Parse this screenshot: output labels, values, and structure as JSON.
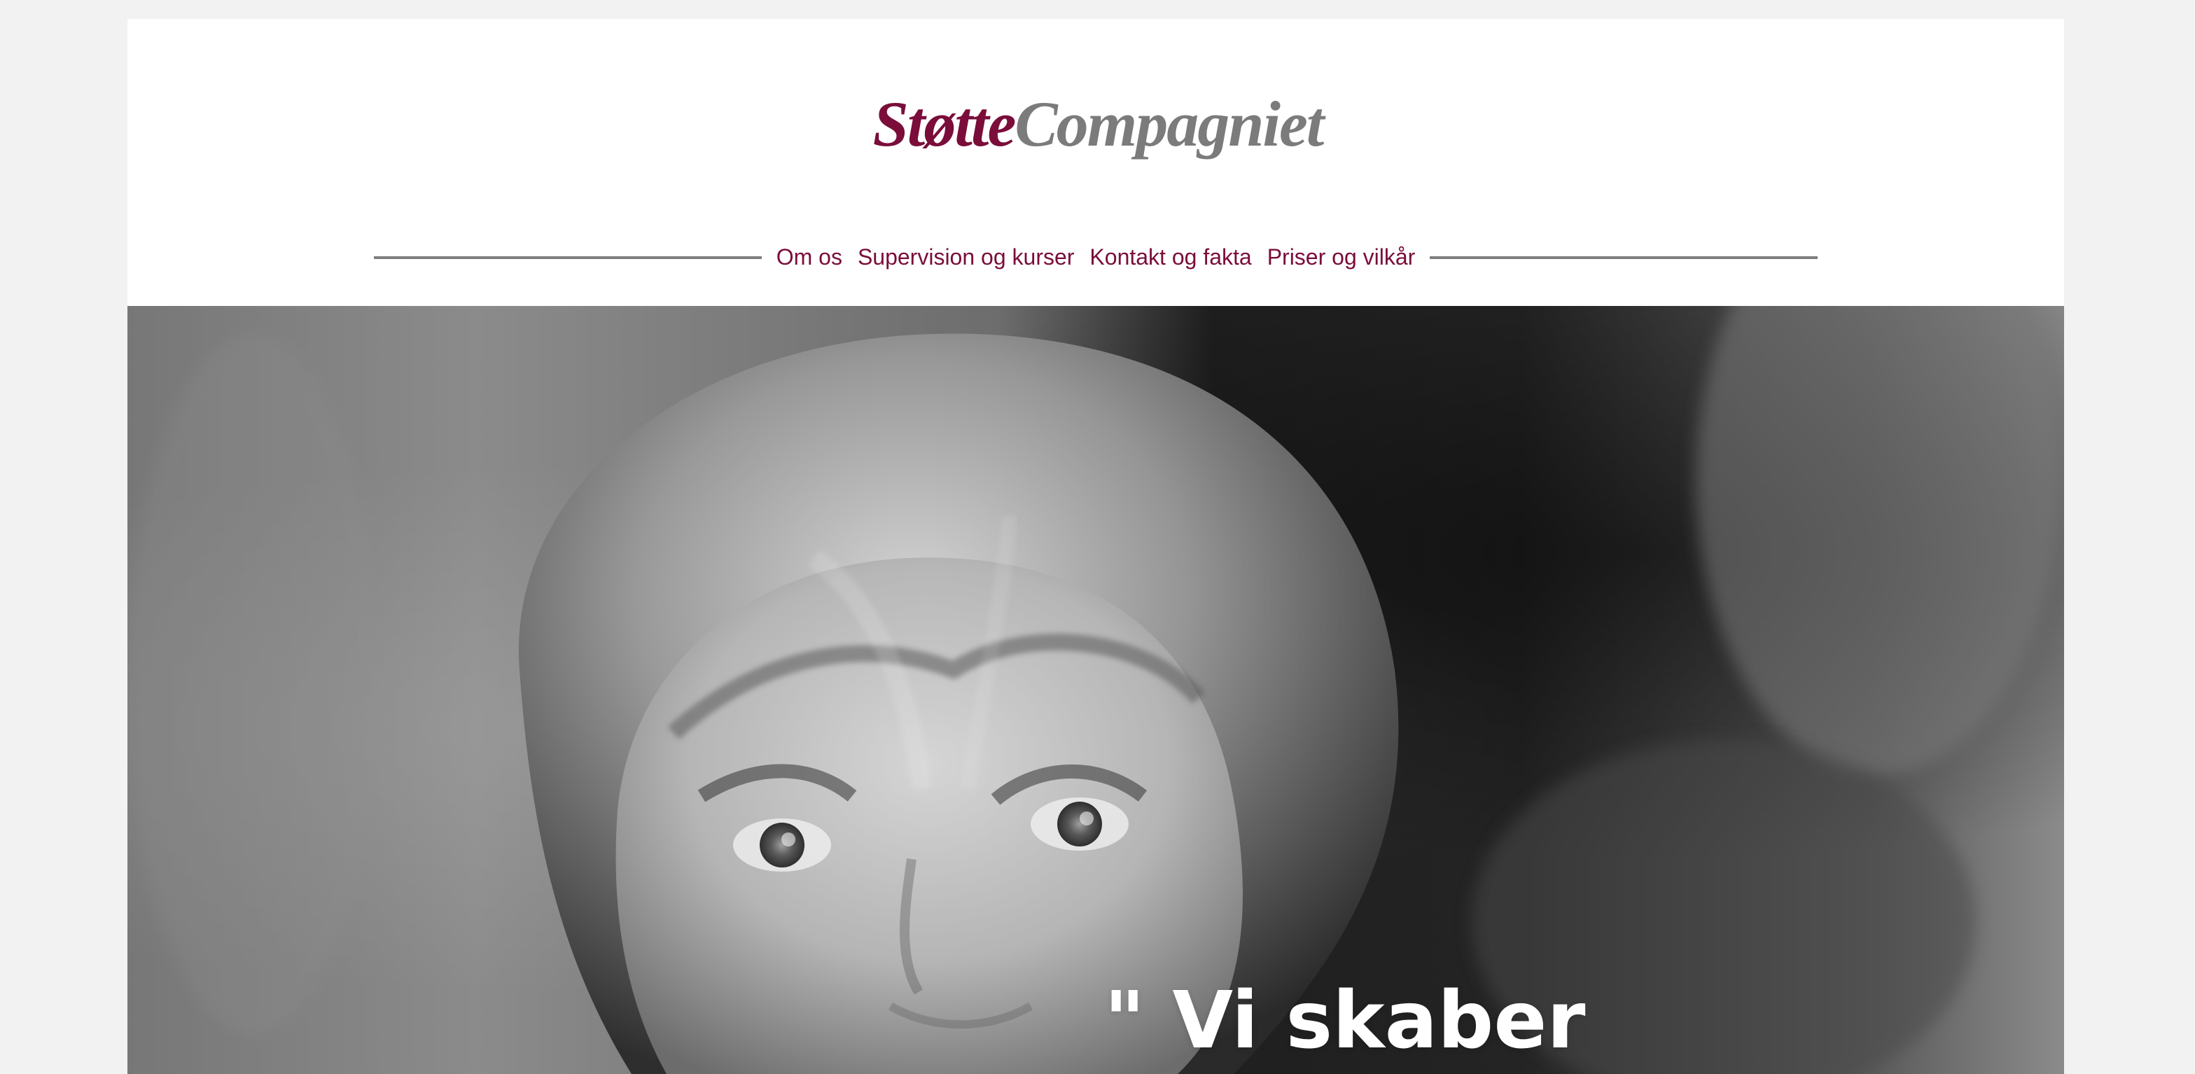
{
  "brand": {
    "logo_part1": "Støtte",
    "logo_part2": "Compagniet",
    "colors": {
      "accent": "#7a0d3a",
      "gray": "#7b7b7b"
    }
  },
  "nav": {
    "items": [
      "Om os",
      "Supervision og kurser",
      "Kontakt og fakta",
      "Priser og vilkår"
    ]
  },
  "hero": {
    "quote": "\" Vi skaber"
  }
}
